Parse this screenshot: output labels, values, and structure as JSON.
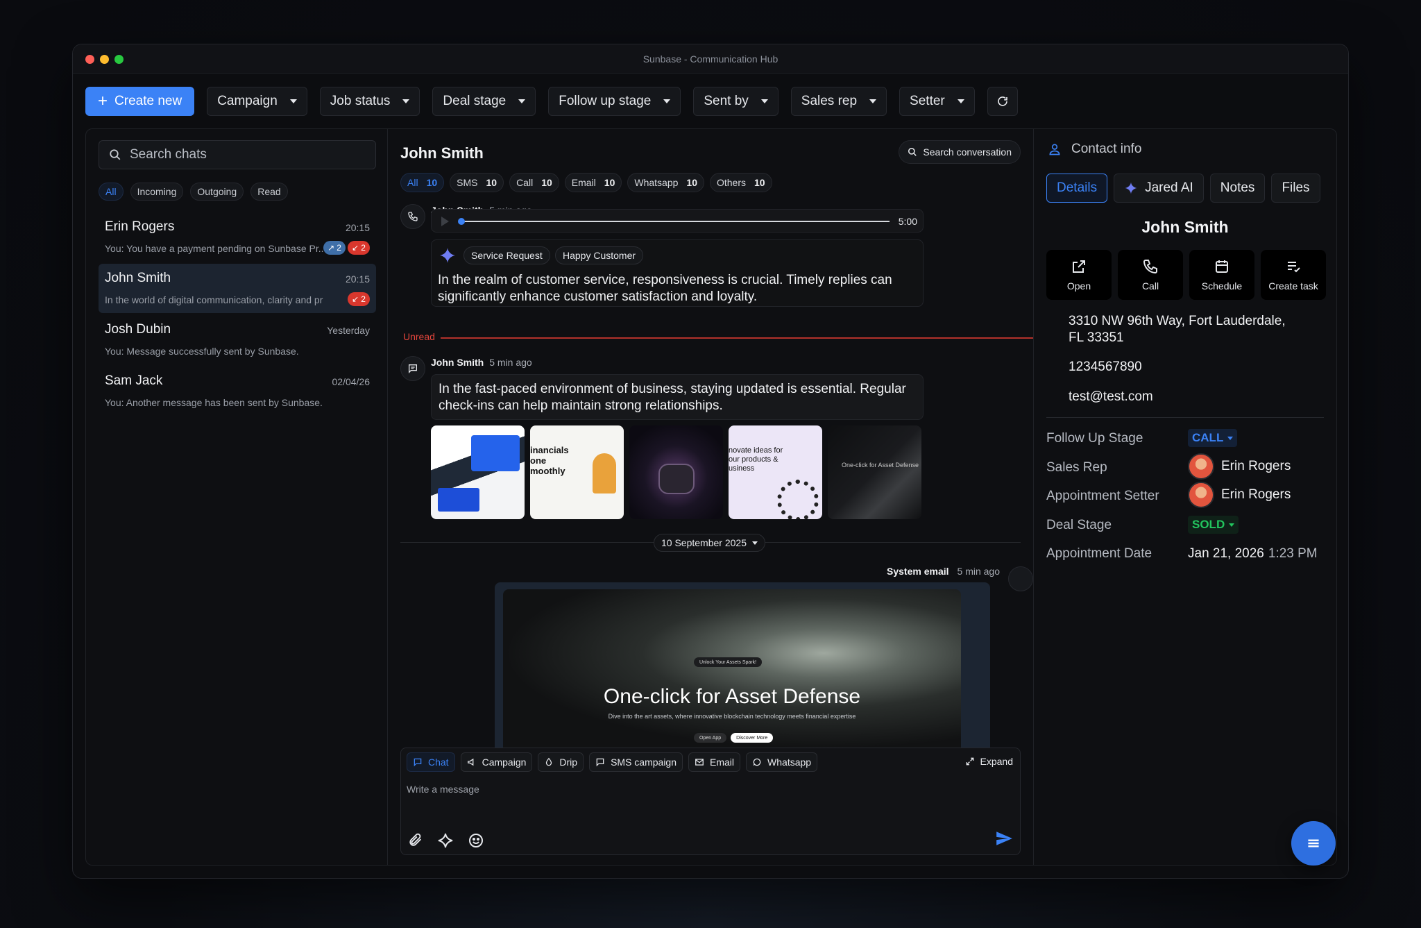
{
  "window": {
    "title": "Sunbase - Communication Hub"
  },
  "toolbar": {
    "create_label": "Create new",
    "filters": [
      "Campaign",
      "Job status",
      "Deal stage",
      "Follow up stage",
      "Sent by",
      "Sales rep",
      "Setter"
    ]
  },
  "left": {
    "search_placeholder": "Search chats",
    "chips": [
      "All",
      "Incoming",
      "Outgoing",
      "Read"
    ],
    "conversations": [
      {
        "name": "Erin Rogers",
        "time": "20:15",
        "preview": "You: You have a payment pending on Sunbase Pr...",
        "badge_blue": "2",
        "badge_red": "2"
      },
      {
        "name": "John Smith",
        "time": "20:15",
        "preview": "In the world of digital communication, clarity and preci...",
        "badge_red": "2"
      },
      {
        "name": "Josh Dubin",
        "time": "Yesterday",
        "preview": "You: Message successfully sent by Sunbase."
      },
      {
        "name": "Sam Jack",
        "time": "02/04/26",
        "preview": "You: Another message has been sent by Sunbase."
      }
    ]
  },
  "middle": {
    "title": "John Smith",
    "search_label": "Search conversation",
    "tabs": [
      {
        "label": "All",
        "count": "10"
      },
      {
        "label": "SMS",
        "count": "10"
      },
      {
        "label": "Call",
        "count": "10"
      },
      {
        "label": "Email",
        "count": "10"
      },
      {
        "label": "Whatsapp",
        "count": "10"
      },
      {
        "label": "Others",
        "count": "10"
      }
    ],
    "call_msg": {
      "sender": "John Smith",
      "time": "5 min ago",
      "duration": "5:00",
      "progress": 0,
      "tags": [
        "Service Request",
        "Happy Customer"
      ],
      "summary": "In the realm of customer service, responsiveness is crucial. Timely replies can significantly enhance customer satisfaction and loyalty."
    },
    "unread_label": "Unread",
    "chat_msg": {
      "sender": "John Smith",
      "time": "5 min ago",
      "text": "In the fast-paced environment of business, staying updated is essential. Regular check-ins can help maintain strong relationships."
    },
    "date_separator": "10 September 2025",
    "system_email": {
      "sender": "System email",
      "time": "5 min ago",
      "headline": "One-click for Asset Defense",
      "subline": "Dive into the art assets, where innovative blockchain technology meets financial expertise",
      "pill": "Unlock Your Assets Spark!",
      "btn1": "Open App",
      "btn2": "Discover More"
    },
    "composer": {
      "tabs": [
        "Chat",
        "Campaign",
        "Drip",
        "SMS campaign",
        "Email",
        "Whatsapp"
      ],
      "expand_label": "Expand",
      "placeholder": "Write a message"
    }
  },
  "right": {
    "header": "Contact info",
    "tabs": [
      "Details",
      "Jared AI",
      "Notes",
      "Files"
    ],
    "name": "John Smith",
    "actions": [
      "Open",
      "Call",
      "Schedule",
      "Create task"
    ],
    "address_line1": "3310 NW 96th Way, Fort Lauderdale,",
    "address_line2": "FL 33351",
    "phone": "1234567890",
    "email": "test@test.com",
    "fields": {
      "follow_up_label": "Follow Up Stage",
      "follow_up_value": "CALL",
      "sales_rep_label": "Sales Rep",
      "sales_rep_value": "Erin Rogers",
      "setter_label": "Appointment Setter",
      "setter_value": "Erin Rogers",
      "deal_label": "Deal Stage",
      "deal_value": "SOLD",
      "appt_label": "Appointment Date",
      "appt_date": "Jan 21, 2026",
      "appt_time": "1:23 PM"
    }
  },
  "colors": {
    "accent": "#3b82f6",
    "unread": "#e2453c",
    "sold": "#22c55e",
    "badge_red": "#d9372d"
  }
}
